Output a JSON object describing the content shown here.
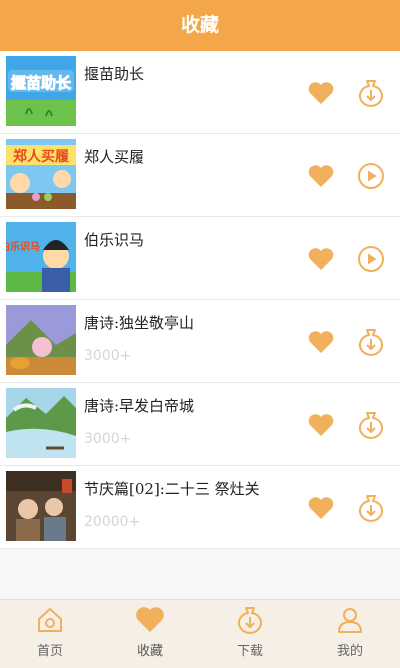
{
  "header": {
    "title": "收藏"
  },
  "list": [
    {
      "title": "揠苗助长",
      "count": "",
      "action": "download",
      "thumb": "seedling"
    },
    {
      "title": "郑人买履",
      "count": "",
      "action": "play",
      "thumb": "shoes"
    },
    {
      "title": "伯乐识马",
      "count": "",
      "action": "play",
      "thumb": "horse"
    },
    {
      "title": "唐诗:独坐敬亭山",
      "count": "3000+",
      "action": "download",
      "thumb": "mountain"
    },
    {
      "title": "唐诗:早发白帝城",
      "count": "3000+",
      "action": "download",
      "thumb": "river"
    },
    {
      "title": "节庆篇[02]:二十三 祭灶关",
      "count": "20000+",
      "action": "download",
      "thumb": "festival"
    }
  ],
  "thumb_text": {
    "seedling": "揠苗助长",
    "shoes": "郑人买履",
    "horse": "伯乐识马"
  },
  "tabs": [
    {
      "label": "首页",
      "icon": "home-icon"
    },
    {
      "label": "收藏",
      "icon": "heart-icon"
    },
    {
      "label": "下载",
      "icon": "download-icon"
    },
    {
      "label": "我的",
      "icon": "user-icon"
    }
  ],
  "colors": {
    "accent": "#f4a74a",
    "icon": "#f0b05c"
  }
}
